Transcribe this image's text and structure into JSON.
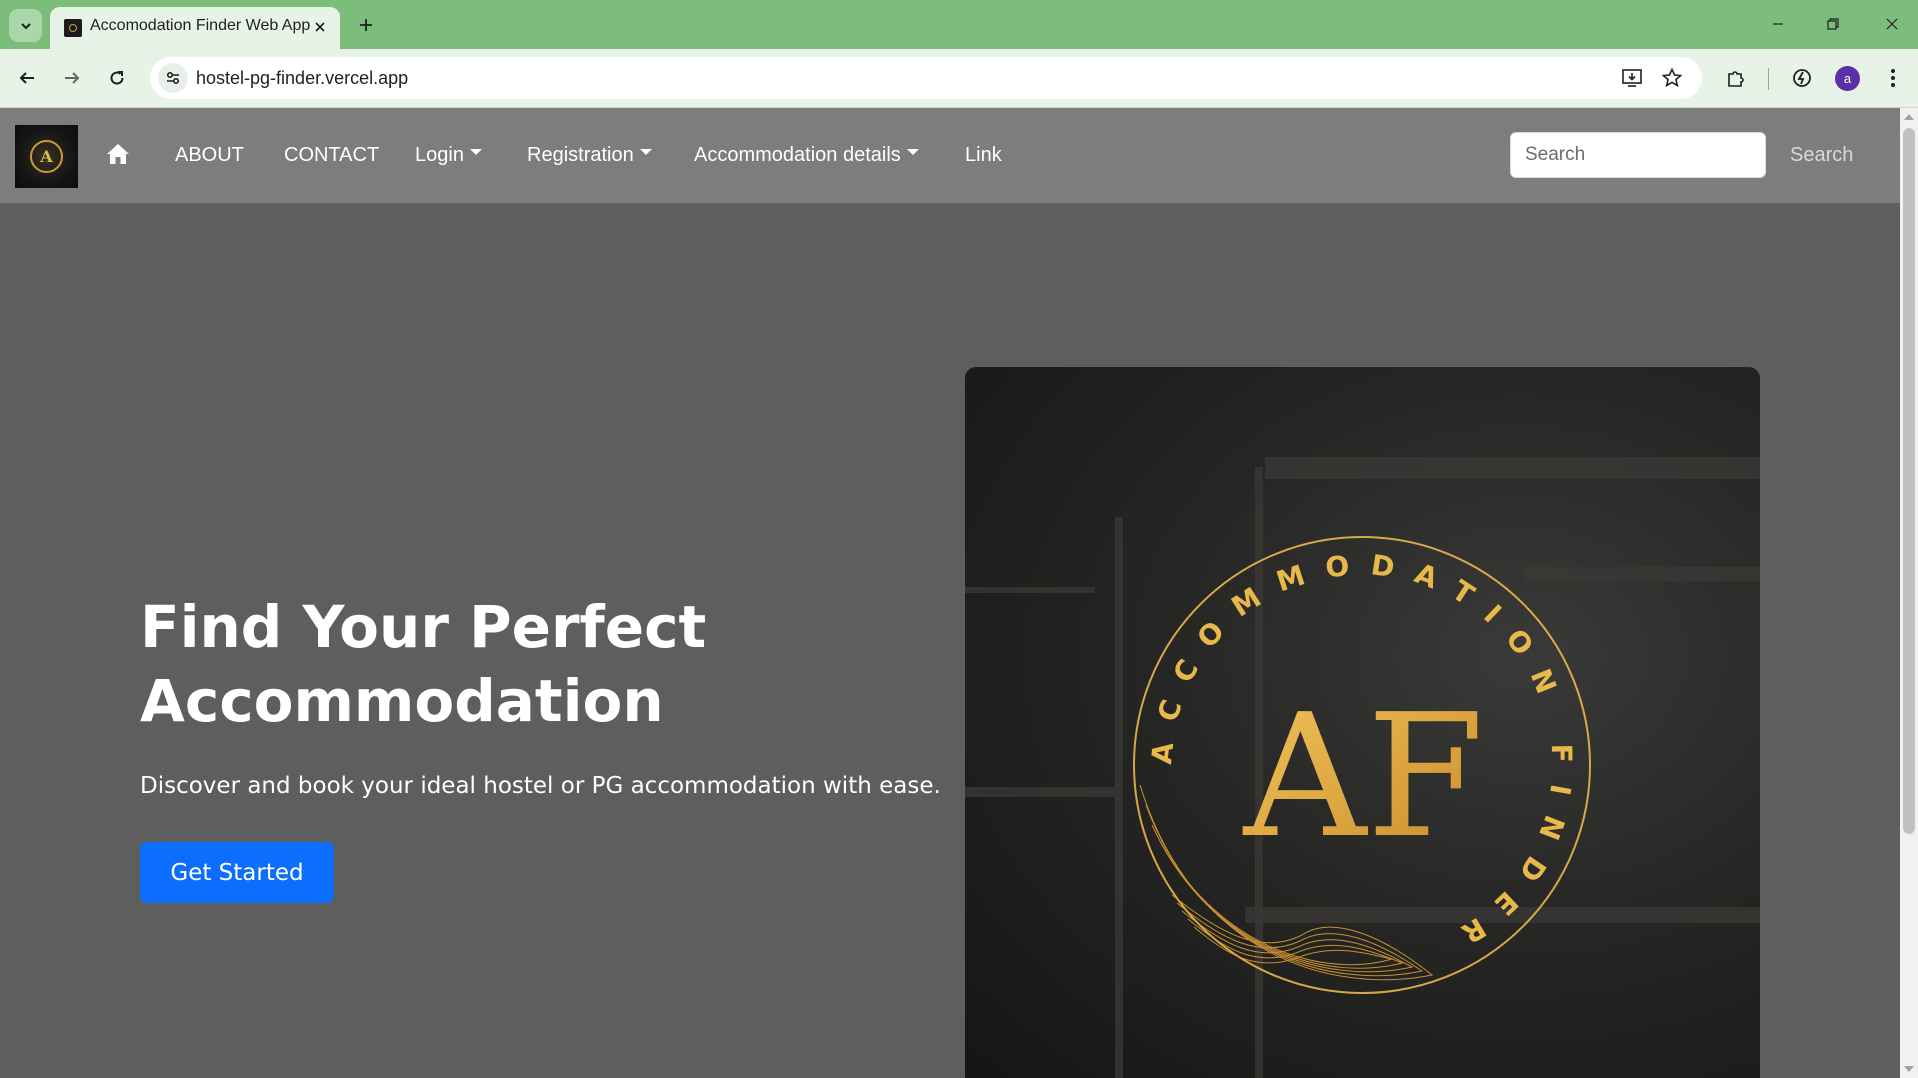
{
  "browser": {
    "tab_title": "Accomodation Finder Web App",
    "url": "hostel-pg-finder.vercel.app",
    "profile_initial": "a"
  },
  "navbar": {
    "links": {
      "about": "ABOUT",
      "contact": "CONTACT",
      "login": "Login",
      "registration": "Registration",
      "accommodation_details": "Accommodation details",
      "link": "Link"
    },
    "search": {
      "placeholder": "Search",
      "button_label": "Search"
    }
  },
  "hero": {
    "title_line1": "Find Your Perfect",
    "title_line2": "Accommodation",
    "subtitle": "Discover and book your ideal hostel or PG accommodation with ease.",
    "cta_label": "Get Started",
    "emblem_ring_text": "ACCOMMODATION FINDER",
    "emblem_monogram": "AF"
  },
  "colors": {
    "browser_frame": "#7cbd7c",
    "navbar_bg": "#7d7d7d",
    "page_bg": "#5e5e5e",
    "cta_bg": "#0d6efd",
    "emblem_gold": "#e9b84a"
  },
  "icons": {
    "tab_search": "chevron-down-icon",
    "tab_close": "close-icon",
    "new_tab": "plus-icon",
    "back": "arrow-left-icon",
    "forward": "arrow-right-icon",
    "reload": "reload-icon",
    "site_info": "tune-icon",
    "install": "install-app-icon",
    "bookmark": "star-icon",
    "extensions": "puzzle-icon",
    "performance": "speed-icon",
    "menu": "kebab-menu-icon",
    "home": "home-icon"
  }
}
